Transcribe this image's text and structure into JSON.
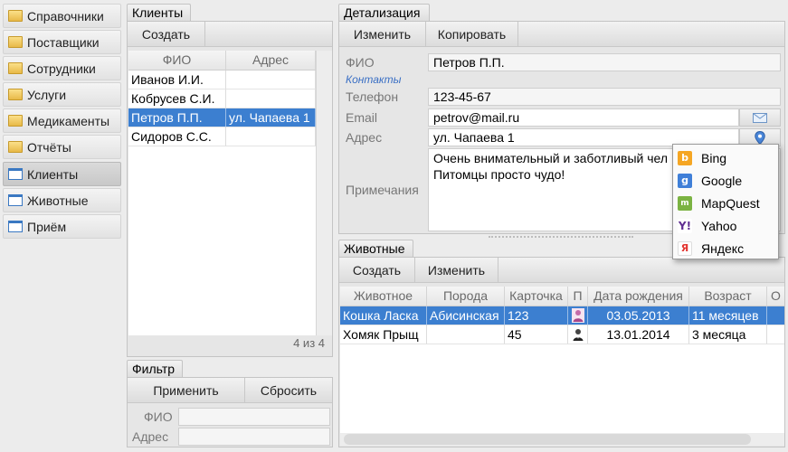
{
  "sidebar": {
    "items": [
      {
        "label": "Справочники",
        "icon": "folder-icon"
      },
      {
        "label": "Поставщики",
        "icon": "folder-icon"
      },
      {
        "label": "Сотрудники",
        "icon": "folder-icon"
      },
      {
        "label": "Услуги",
        "icon": "folder-icon"
      },
      {
        "label": "Медикаменты",
        "icon": "folder-icon"
      },
      {
        "label": "Отчёты",
        "icon": "folder-icon"
      },
      {
        "label": "Клиенты",
        "icon": "window-icon",
        "active": true
      },
      {
        "label": "Животные",
        "icon": "window-icon"
      },
      {
        "label": "Приём",
        "icon": "window-icon"
      }
    ]
  },
  "clients": {
    "tab": "Клиенты",
    "create": "Создать",
    "columns": [
      "ФИО",
      "Адрес"
    ],
    "rows": [
      {
        "name": "Иванов И.И.",
        "address": ""
      },
      {
        "name": "Кобрусев С.И.",
        "address": ""
      },
      {
        "name": "Петров П.П.",
        "address": "ул. Чапаева 1",
        "selected": true
      },
      {
        "name": "Сидоров С.С.",
        "address": ""
      }
    ],
    "count": "4 из 4"
  },
  "filter": {
    "tab": "Фильтр",
    "apply": "Применить",
    "reset": "Сбросить",
    "fio_label": "ФИО",
    "address_label": "Адрес",
    "fio_value": "",
    "address_value": ""
  },
  "details": {
    "tab": "Детализация",
    "edit": "Изменить",
    "copy": "Копировать",
    "fio_label": "ФИО",
    "fio_value": "Петров П.П.",
    "contacts_label": "Контакты",
    "phone_label": "Телефон",
    "phone_value": "123-45-67",
    "email_label": "Email",
    "email_value": "petrov@mail.ru",
    "address_label": "Адрес",
    "address_value": "ул. Чапаева 1",
    "notes_label": "Примечания",
    "notes_line1": "Очень внимательный и заботливый чел",
    "notes_line2": "Питомцы просто чудо!"
  },
  "map_menu": {
    "items": [
      {
        "label": "Bing",
        "icon": "bing-icon",
        "color": "#f5a623"
      },
      {
        "label": "Google",
        "icon": "google-icon",
        "color": "#3f7fd8"
      },
      {
        "label": "MapQuest",
        "icon": "mapquest-icon",
        "color": "#7bb342"
      },
      {
        "label": "Yahoo",
        "icon": "yahoo-icon",
        "color": "#5f2d91"
      },
      {
        "label": "Яндекс",
        "icon": "yandex-icon",
        "color": "#e3342f"
      }
    ]
  },
  "animals": {
    "tab": "Животные",
    "create": "Создать",
    "edit": "Изменить",
    "columns": [
      "Животное",
      "Порода",
      "Карточка",
      "П",
      "Дата рождения",
      "Возраст",
      "О"
    ],
    "rows": [
      {
        "animal": "Кошка Ласка",
        "breed": "Абисинская",
        "card": "123",
        "sex": "female-icon",
        "birth": "03.05.2013",
        "age": "11 месяцев",
        "selected": true
      },
      {
        "animal": "Хомяк Прыщ",
        "breed": "",
        "card": "45",
        "sex": "male-icon",
        "birth": "13.01.2014",
        "age": "3 месяца"
      }
    ]
  },
  "colors": {
    "selection": "#3c7fd0",
    "contacts_link": "#3a6fc4"
  }
}
